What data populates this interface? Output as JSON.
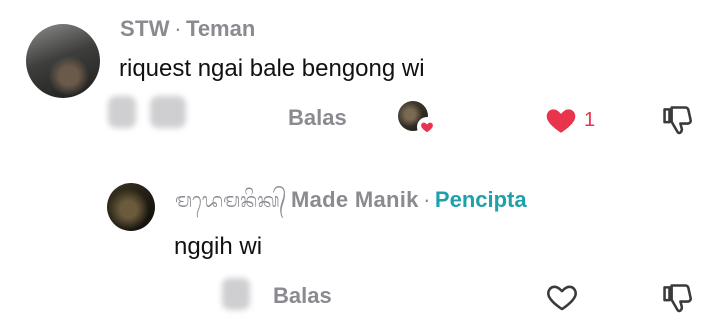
{
  "comment1": {
    "username": "STW",
    "separator": "·",
    "badge": "Teman",
    "text": "riquest ngai bale bengong wi",
    "reply_label": "Balas",
    "like_count": "1",
    "liked": true
  },
  "comment2": {
    "script_name": "ᬫᬤᬾᬫᬦᬶᬓ᭄",
    "username": "Made Manik",
    "separator": "·",
    "badge": "Pencipta",
    "text": "nggih wi",
    "reply_label": "Balas",
    "liked": false
  },
  "colors": {
    "like_red": "#e8344c",
    "creator_teal": "#20a0a8",
    "muted_gray": "#8a8b91"
  },
  "icons": {
    "like_filled": "heart-filled-icon",
    "like_outline": "heart-outline-icon",
    "dislike": "thumbs-down-icon"
  }
}
